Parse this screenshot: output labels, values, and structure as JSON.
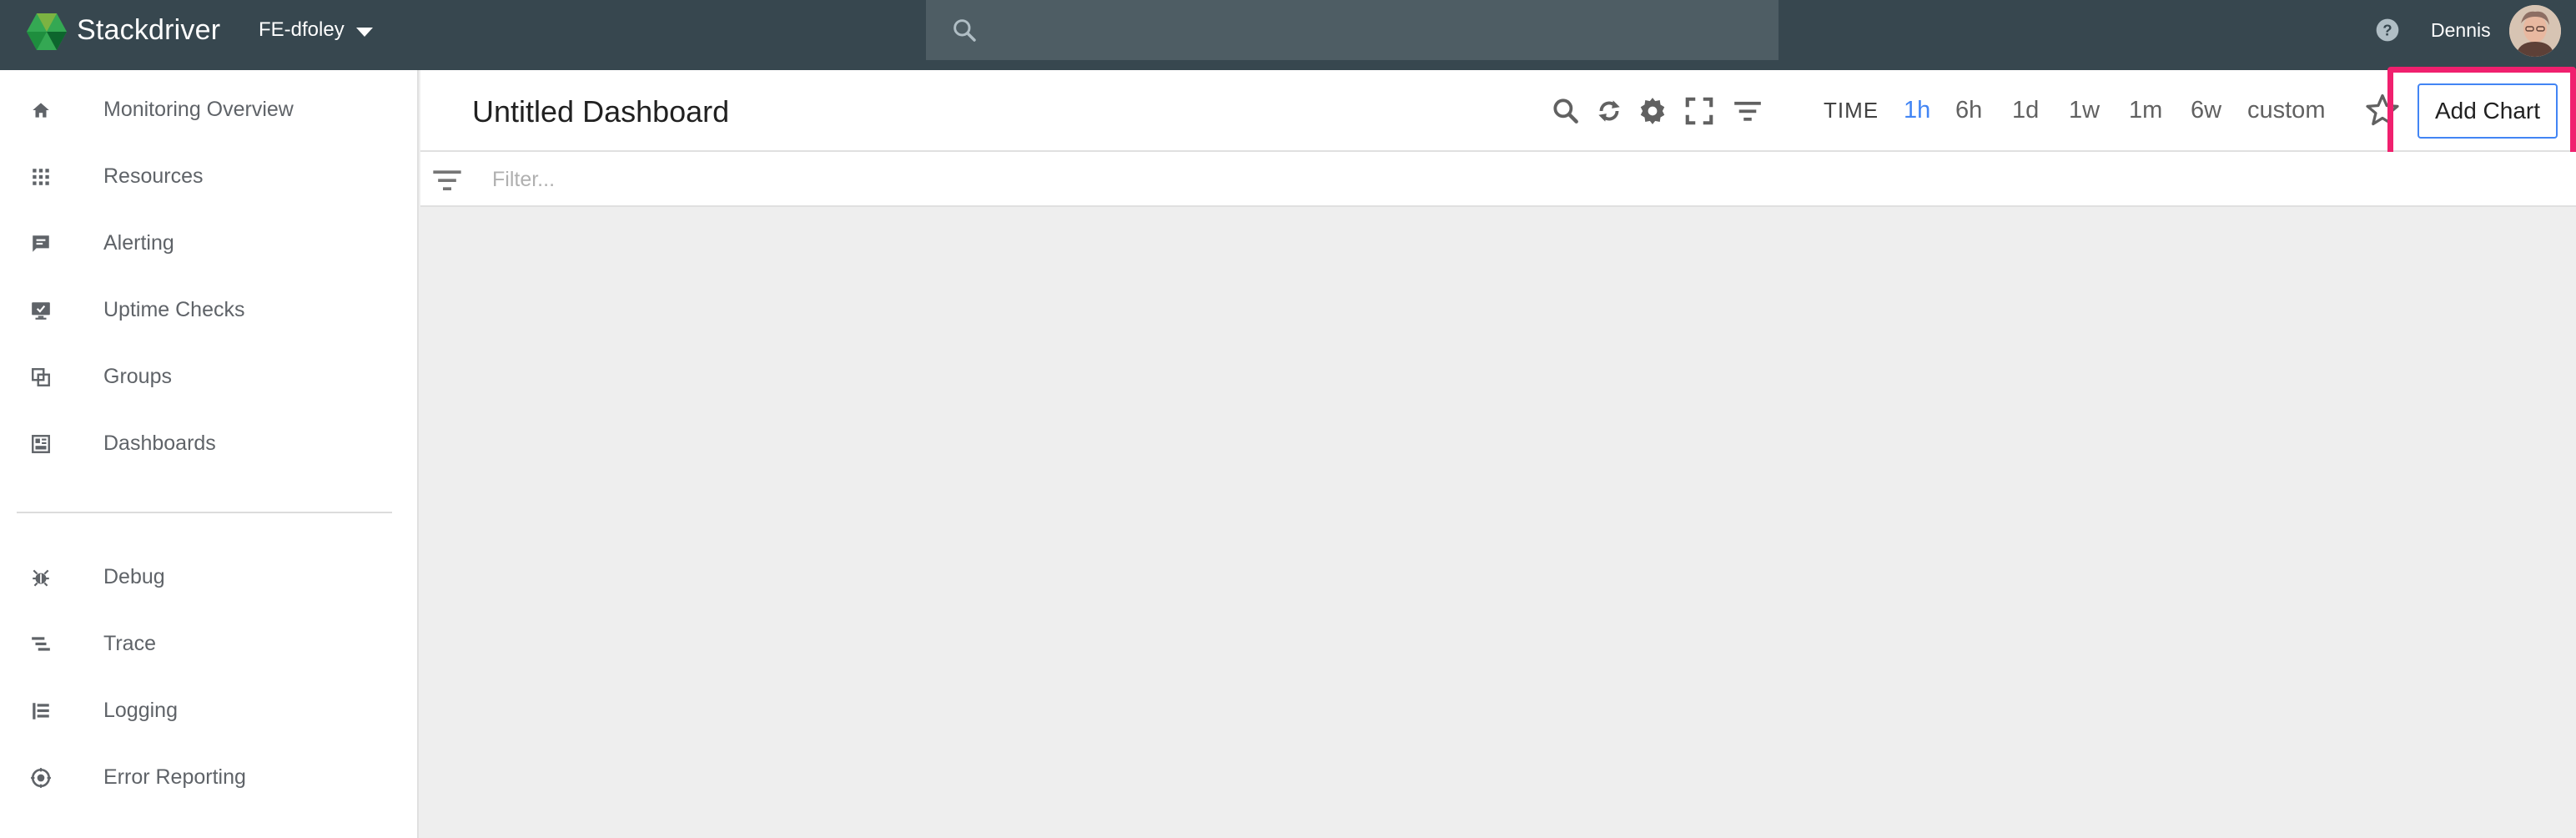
{
  "topbar": {
    "brand": "Stackdriver",
    "project": "FE-dfoley",
    "search_placeholder": "",
    "username": "Dennis",
    "icons": {
      "logo": "stackdriver-logo",
      "search": "search-icon",
      "help": "help-icon",
      "avatar": "user-avatar"
    }
  },
  "sidebar": {
    "primary": [
      {
        "label": "Monitoring Overview",
        "icon": "home-icon"
      },
      {
        "label": "Resources",
        "icon": "grid-icon"
      },
      {
        "label": "Alerting",
        "icon": "alert-message-icon"
      },
      {
        "label": "Uptime Checks",
        "icon": "monitor-icon"
      },
      {
        "label": "Groups",
        "icon": "groups-icon"
      },
      {
        "label": "Dashboards",
        "icon": "dashboard-icon"
      }
    ],
    "secondary": [
      {
        "label": "Debug",
        "icon": "debug-icon"
      },
      {
        "label": "Trace",
        "icon": "trace-icon"
      },
      {
        "label": "Logging",
        "icon": "logging-icon"
      },
      {
        "label": "Error Reporting",
        "icon": "error-reporting-icon"
      }
    ]
  },
  "dashboard": {
    "title": "Untitled Dashboard",
    "tools": [
      "zoom-icon",
      "refresh-icon",
      "settings-icon",
      "fullscreen-icon",
      "filter-lines-icon"
    ],
    "time_label": "TIME",
    "time_options": [
      "1h",
      "6h",
      "1d",
      "1w",
      "1m",
      "6w",
      "custom"
    ],
    "active_time": "1h",
    "add_chart_label": "Add Chart",
    "highlight_color": "#f0206e"
  },
  "filter": {
    "placeholder": "Filter..."
  },
  "colors": {
    "topbar": "#37474f",
    "search": "#4e5d64",
    "accent": "#4285f4",
    "canvas": "#eeeeee"
  }
}
